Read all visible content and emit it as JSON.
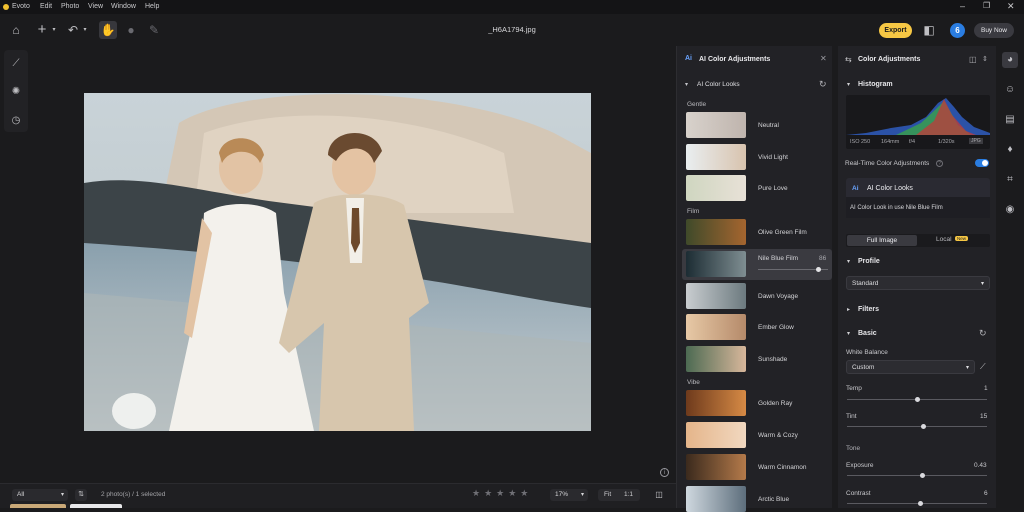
{
  "app": {
    "name": "Evoto",
    "file_name": "_H6A1794.jpg"
  },
  "menu": [
    "Evoto",
    "Edit",
    "Photo",
    "View",
    "Window",
    "Help"
  ],
  "toolbar": {
    "export_label": "Export",
    "badge_count": "6",
    "buy_label": "Buy Now"
  },
  "statusbar": {
    "filter": "All",
    "selection": "2 photo(s) / 1 selected",
    "zoom": "17%",
    "fit": "Fit",
    "one_to_one": "1:1"
  },
  "looks_panel": {
    "title": "AI Color Adjustments",
    "section_title": "AI Color Looks",
    "groups": [
      {
        "name": "Gentle",
        "items": [
          "Neutral",
          "Vivid Light",
          "Pure Love"
        ]
      },
      {
        "name": "Film",
        "items": [
          "Olive Green Film",
          "Nile Blue Film",
          "Dawn Voyage",
          "Ember Glow",
          "Sunshade"
        ]
      },
      {
        "name": "Vibe",
        "items": [
          "Golden Ray",
          "Warm & Cozy",
          "Warm Cinnamon",
          "Arctic Blue"
        ]
      }
    ],
    "selected_value": "86",
    "selected_strength": 0.86
  },
  "adjust_panel": {
    "title": "Color Adjustments",
    "histogram_title": "Histogram",
    "camera_info": [
      "ISO 250",
      "164mm",
      "f/4",
      "1/320s"
    ],
    "camera_format": "JPG",
    "realtime_label": "Real-Time Color Adjustments",
    "ai_looks_title": "AI Color Looks",
    "ai_looks_note": "AI Color Look in use Nile Blue Film",
    "tab_full": "Full Image",
    "tab_local": "Local",
    "tab_new": "New",
    "profile_title": "Profile",
    "profile_value": "Standard",
    "filters_title": "Filters",
    "basic_title": "Basic",
    "wb_label": "White Balance",
    "wb_value": "Custom",
    "temp_label": "Temp",
    "temp_value": "1",
    "tint_label": "Tint",
    "tint_value": "15",
    "tone_label": "Tone",
    "exposure_label": "Exposure",
    "exposure_value": "0.43",
    "contrast_label": "Contrast",
    "contrast_value": "6"
  },
  "colors": {
    "accent": "#f6c744",
    "blue": "#2a7de1",
    "panel": "#222226"
  }
}
